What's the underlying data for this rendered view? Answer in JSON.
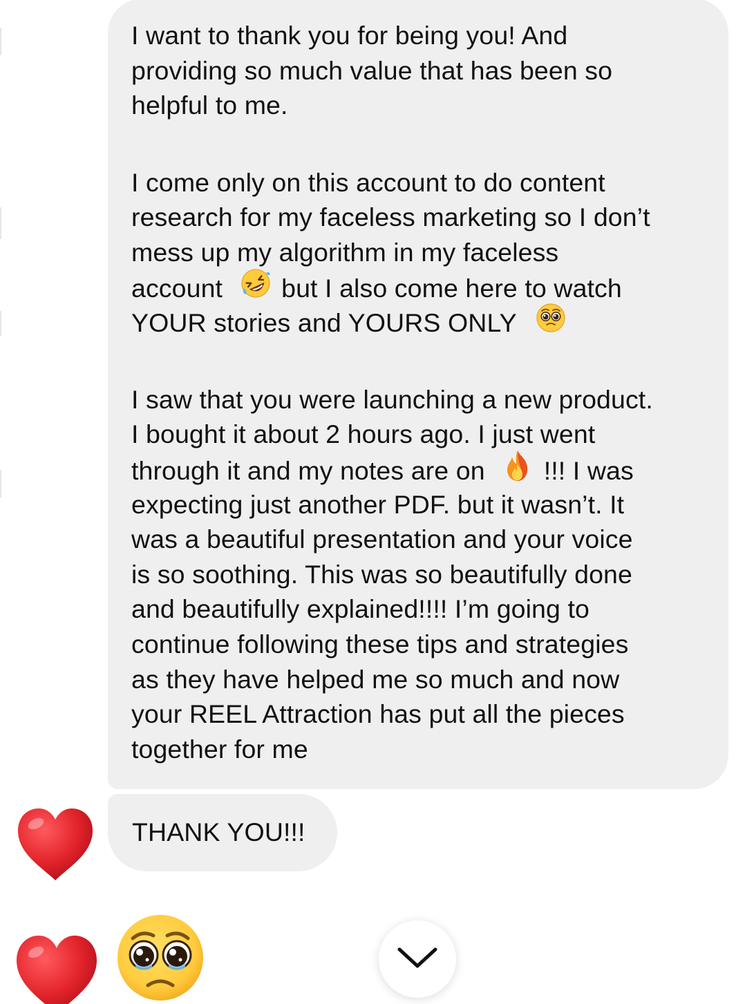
{
  "message": {
    "paragraphs": [
      {
        "lines": [
          "I want to thank you for being you! And",
          "providing so much value that has been so",
          "helpful to me."
        ]
      },
      {
        "lines": [
          "I come only on this account to do content",
          "research for my faceless marketing so I don’t",
          "mess up my algorithm in my faceless",
          "account",
          "but I also come here to watch",
          "YOUR stories and YOURS ONLY"
        ]
      },
      {
        "lines": [
          "I saw that you were launching a new product.",
          "I bought it about 2 hours ago. I just went",
          "through it and my notes are on",
          "!!! I was",
          "expecting just another PDF. but it wasn’t. It",
          "was a beautiful presentation and your voice",
          "is so soothing. This was so beautifully done",
          "and beautifully explained!!!! I’m going to",
          "continue following these tips and strategies",
          "as they have helped me so much and now",
          "your REEL Attraction has put all the pieces",
          "together for me"
        ]
      }
    ]
  },
  "thanks_message": "THANK YOU!!!",
  "reactions": [
    "red-heart",
    "red-heart"
  ],
  "emoji_message": "pleading-face",
  "inline_emojis": [
    "rolling-on-floor-laughing",
    "pleading-face",
    "fire"
  ],
  "scroll_button": "chevron-down",
  "colors": {
    "bubble": "#efefef",
    "text": "#111111",
    "heart": "#e3242b",
    "emoji_face": "#ffcb3d"
  }
}
